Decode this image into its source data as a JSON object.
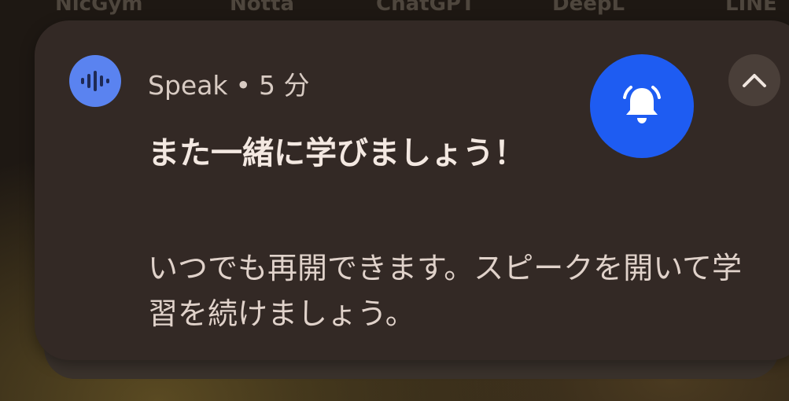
{
  "background_apps": [
    "NicGym",
    "Notta",
    "ChatGPT",
    "DeepL",
    "LINE"
  ],
  "notification": {
    "app_name": "Speak",
    "separator": "•",
    "time_ago": "5 分",
    "app_icon": "waveform-icon",
    "badge_icon": "alarm-bell-icon",
    "collapse_icon": "chevron-up-icon",
    "title": "また一緒に学びましょう！",
    "body": "いつでも再開できます。スピークを開いて学習を続けましょう。"
  },
  "colors": {
    "card": "#332925",
    "app_icon_bg": "#5a83f0",
    "badge_bg": "#1e5cf2",
    "title_text": "#f3e8e1",
    "body_text": "#e0d2ca"
  }
}
